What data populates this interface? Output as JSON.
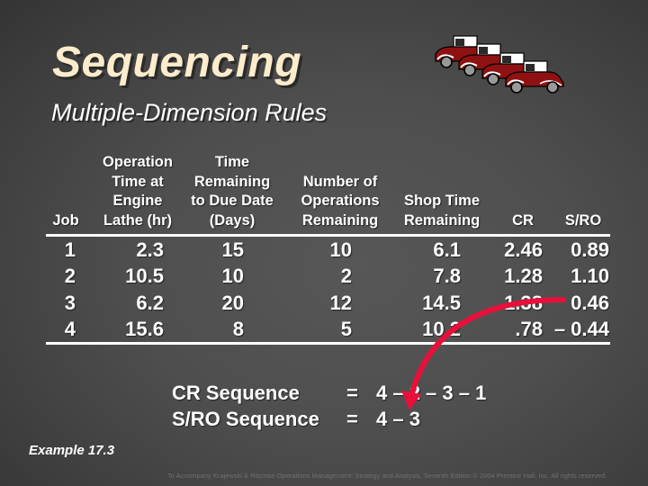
{
  "slide": {
    "title": "Sequencing",
    "subtitle": "Multiple-Dimension Rules",
    "image": "vintage-cars-icon",
    "example_label": "Example 17.3",
    "footer": "To Accompany Krajewski & Ritzman Operations Management: Strategy and Analysis, Seventh Edition © 2004 Prentice Hall, Inc. All rights reserved.",
    "accent_color": "#e8103a"
  },
  "table": {
    "headers": [
      {
        "lines": [
          "",
          "",
          "",
          "Job"
        ]
      },
      {
        "lines": [
          "Operation",
          "Time at",
          "Engine",
          "Lathe (hr)"
        ]
      },
      {
        "lines": [
          "Time",
          "Remaining",
          "to Due Date",
          "(Days)"
        ]
      },
      {
        "lines": [
          "",
          "Number of",
          "Operations",
          "Remaining"
        ]
      },
      {
        "lines": [
          "",
          "",
          "Shop Time",
          "Remaining"
        ]
      },
      {
        "lines": [
          "",
          "",
          "",
          "CR"
        ]
      },
      {
        "lines": [
          "",
          "",
          "",
          "S/RO"
        ]
      }
    ],
    "rows": [
      {
        "job": "1",
        "op_time": "2.3",
        "time_remaining": "15",
        "ops_remaining": "10",
        "shop_time": "6.1",
        "cr": "2.46",
        "sro": "0.89"
      },
      {
        "job": "2",
        "op_time": "10.5",
        "time_remaining": "10",
        "ops_remaining": "2",
        "shop_time": "7.8",
        "cr": "1.28",
        "sro": "1.10"
      },
      {
        "job": "3",
        "op_time": "6.2",
        "time_remaining": "20",
        "ops_remaining": "12",
        "shop_time": "14.5",
        "cr": "1.38",
        "sro": "0.46"
      },
      {
        "job": "4",
        "op_time": "15.6",
        "time_remaining": "8",
        "ops_remaining": "5",
        "shop_time": "10.2",
        "cr": ".78",
        "sro": "– 0.44"
      }
    ]
  },
  "sequences": {
    "cr_label": "CR Sequence",
    "cr_eq": "=",
    "cr_value": "4 – 2 – 3 – 1",
    "sro_label": "S/RO Sequence",
    "sro_eq": "=",
    "sro_value": "4 – 3"
  }
}
